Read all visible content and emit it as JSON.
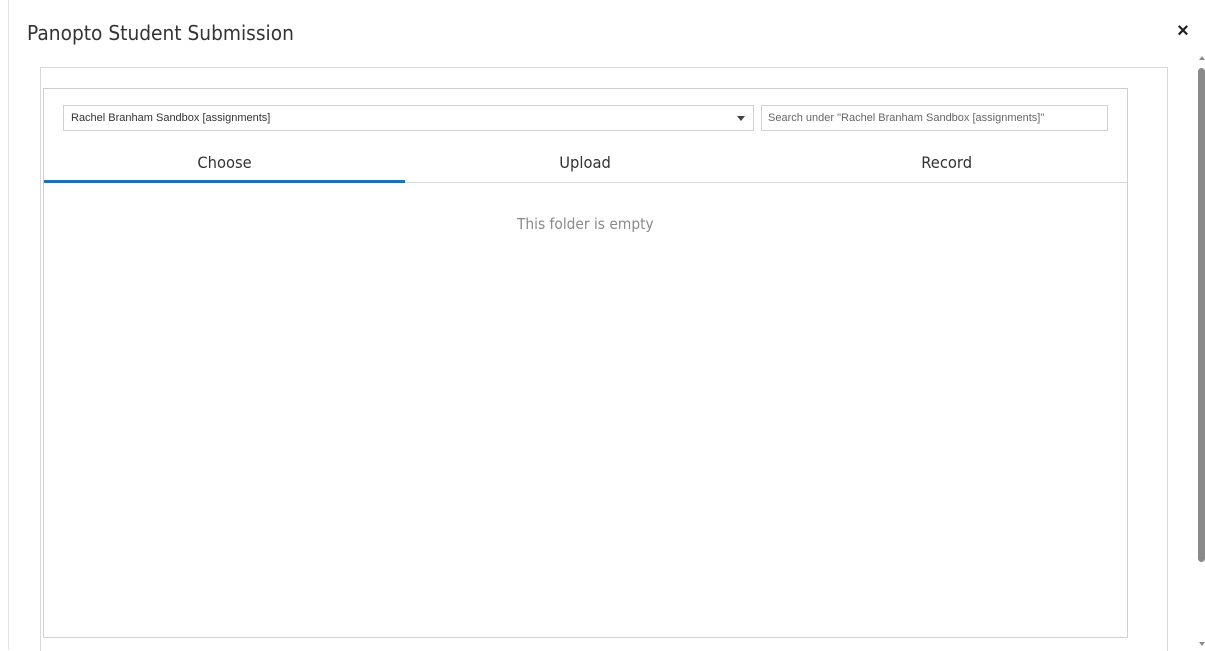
{
  "modal": {
    "title": "Panopto Student Submission",
    "close_label": "×"
  },
  "folder_select": {
    "selected": "Rachel Branham Sandbox [assignments]"
  },
  "search": {
    "placeholder": "Search under \"Rachel Branham Sandbox [assignments]\""
  },
  "tabs": [
    {
      "label": "Choose",
      "active": true
    },
    {
      "label": "Upload",
      "active": false
    },
    {
      "label": "Record",
      "active": false
    }
  ],
  "content": {
    "empty_message": "This folder is empty"
  },
  "colors": {
    "accent": "#1f6fb5",
    "muted_text": "#8a8a8a",
    "border": "#d0d0d0"
  },
  "icons": {
    "close": "close-icon",
    "dropdown": "chevron-down-icon"
  }
}
